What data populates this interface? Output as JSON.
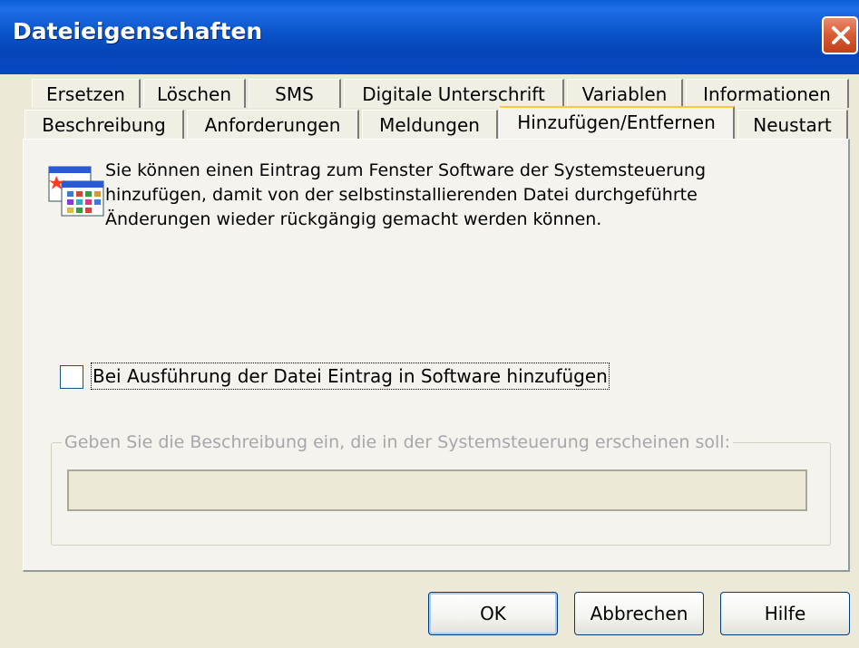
{
  "window": {
    "title": "Dateieigenschaften"
  },
  "tabs_row1": [
    "Ersetzen",
    "Löschen",
    "SMS",
    "Digitale Unterschrift",
    "Variablen",
    "Informationen"
  ],
  "tabs_row2": [
    "Beschreibung",
    "Anforderungen",
    "Meldungen",
    "Hinzufügen/Entfernen",
    "Neustart"
  ],
  "active_tab": "Hinzufügen/Entfernen",
  "panel": {
    "info_text": "Sie können einen Eintrag zum Fenster Software der Systemsteuerung hinzufügen, damit von der selbstinstallierenden Datei durchgeführte Änderungen wieder rückgängig gemacht werden können.",
    "checkbox_label": "Bei Ausführung der Datei Eintrag in Software hinzufügen",
    "checkbox_checked": false,
    "group_label": "Geben Sie die Beschreibung ein, die in der Systemsteuerung erscheinen soll:",
    "description_value": ""
  },
  "buttons": {
    "ok": "OK",
    "cancel": "Abbrechen",
    "help": "Hilfe"
  },
  "icons": {
    "close": "close-icon",
    "app": "control-panel-icon"
  }
}
